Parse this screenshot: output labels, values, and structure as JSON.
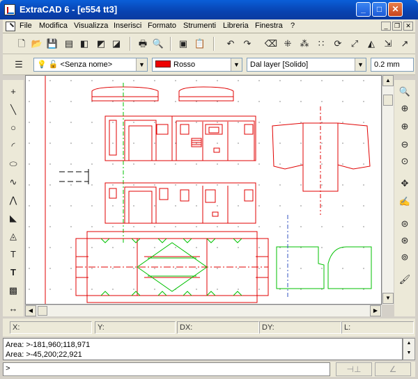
{
  "window": {
    "title": "ExtraCAD 6 - [e554 tt3]"
  },
  "menu": {
    "items": [
      "File",
      "Modifica",
      "Visualizza",
      "Inserisci",
      "Formato",
      "Strumenti",
      "Libreria",
      "Finestra",
      "?"
    ]
  },
  "layer_bar": {
    "layer_value": "<Senza nome>",
    "color_value": "Rosso",
    "linetype_value": "Dal layer [Solido]",
    "lineweight_value": "0.2 mm"
  },
  "status": {
    "x_label": "X:",
    "y_label": "Y:",
    "dx_label": "DX:",
    "dy_label": "DY:",
    "l_label": "L:"
  },
  "command_output": {
    "line1": "Area: >-181,960;118,971",
    "line2": "Area: >-45,200;22,921"
  },
  "command_line": {
    "prompt": ">"
  },
  "colors": {
    "drawing_red": "#e00000",
    "drawing_green": "#00c000",
    "drawing_grid": "#707070",
    "title_blue": "#0a46c0"
  }
}
